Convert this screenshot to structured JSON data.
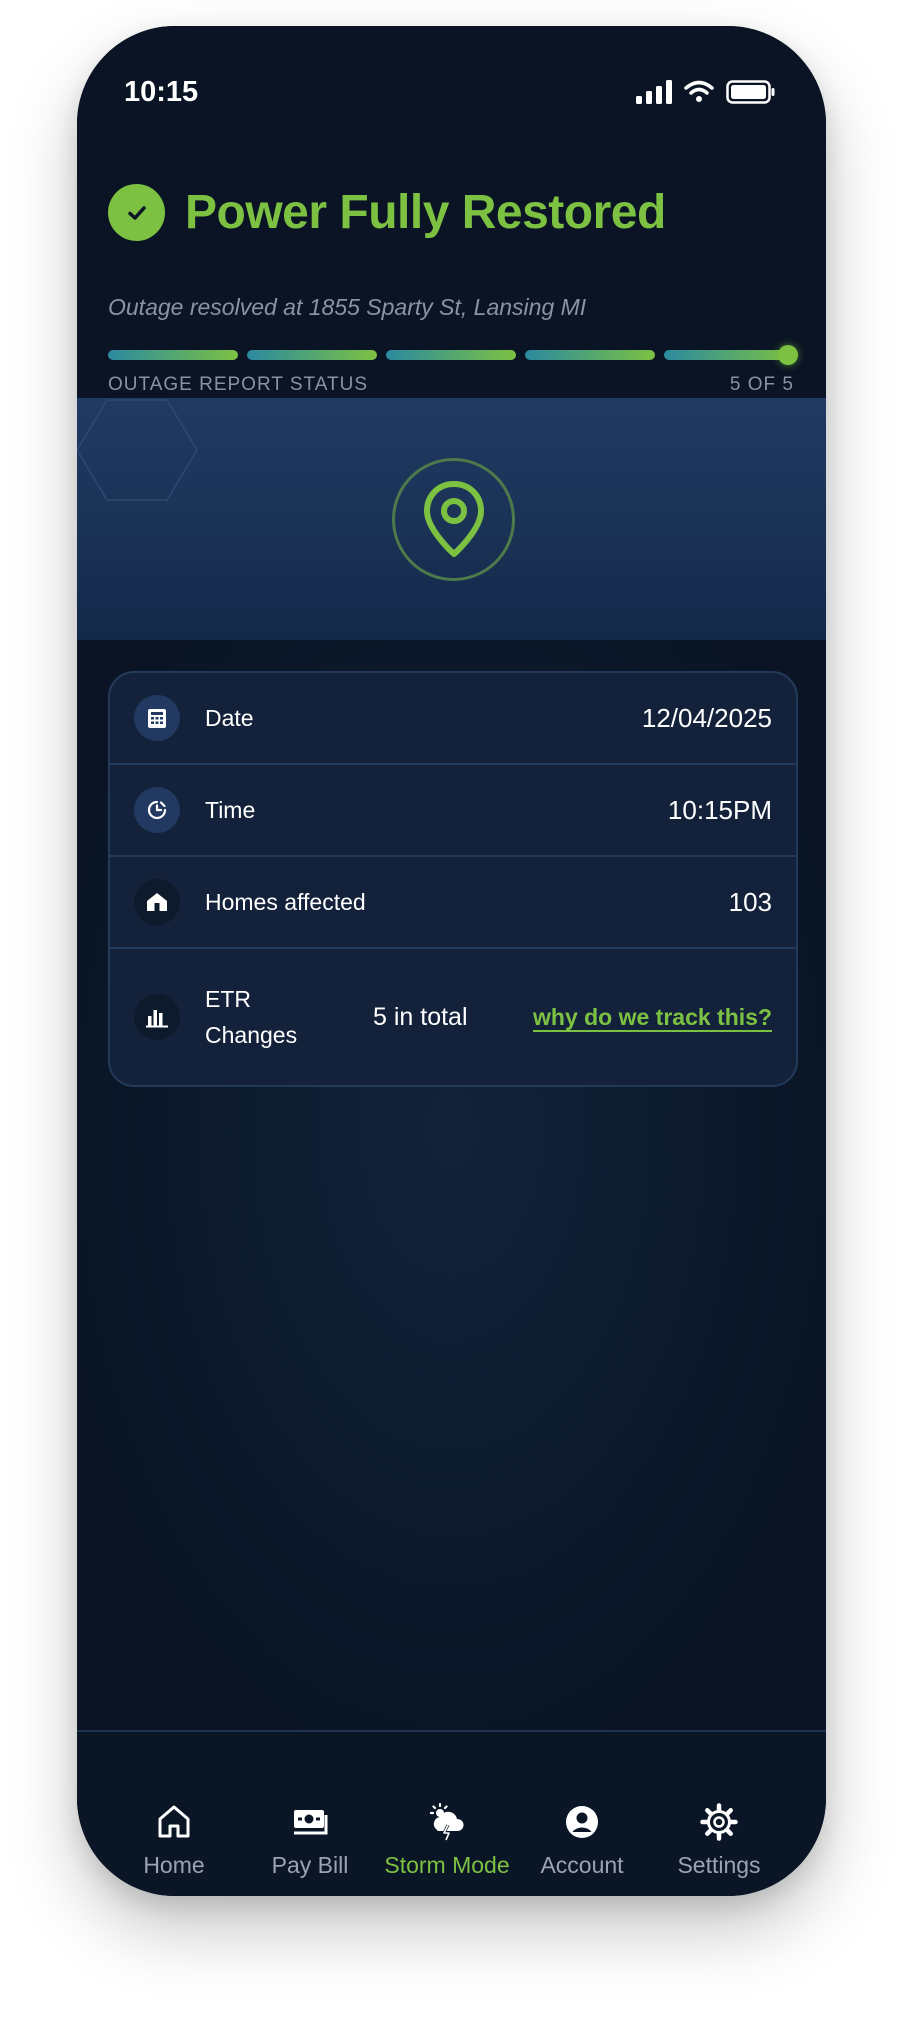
{
  "status_bar": {
    "time": "10:15"
  },
  "header": {
    "title": "Power Fully Restored",
    "subtitle": "Outage resolved at 1855 Sparty St, Lansing MI",
    "progress": {
      "current": 5,
      "total": 5,
      "label": "OUTAGE REPORT STATUS",
      "count_label": "5 OF 5"
    }
  },
  "details": {
    "date": {
      "label": "Date",
      "value": "12/04/2025",
      "icon": "calendar-icon"
    },
    "time": {
      "label": "Time",
      "value": "10:15PM",
      "icon": "clock-icon"
    },
    "homes": {
      "label": "Homes affected",
      "value": "103",
      "icon": "house-icon"
    },
    "etr": {
      "label_line1": "ETR",
      "label_line2": "Changes",
      "value": "5 in total",
      "link": "why do we track this?",
      "icon": "bar-chart-icon"
    }
  },
  "tabs": [
    {
      "label": "Home",
      "icon": "home-icon",
      "active": false
    },
    {
      "label": "Pay Bill",
      "icon": "bill-icon",
      "active": false
    },
    {
      "label": "Storm Mode",
      "icon": "storm-icon",
      "active": true
    },
    {
      "label": "Account",
      "icon": "account-icon",
      "active": false
    },
    {
      "label": "Settings",
      "icon": "gear-icon",
      "active": false
    }
  ],
  "colors": {
    "accent": "#7cc142",
    "background": "#0a1424",
    "card": "#13223a",
    "muted_text": "#8a93a3"
  }
}
